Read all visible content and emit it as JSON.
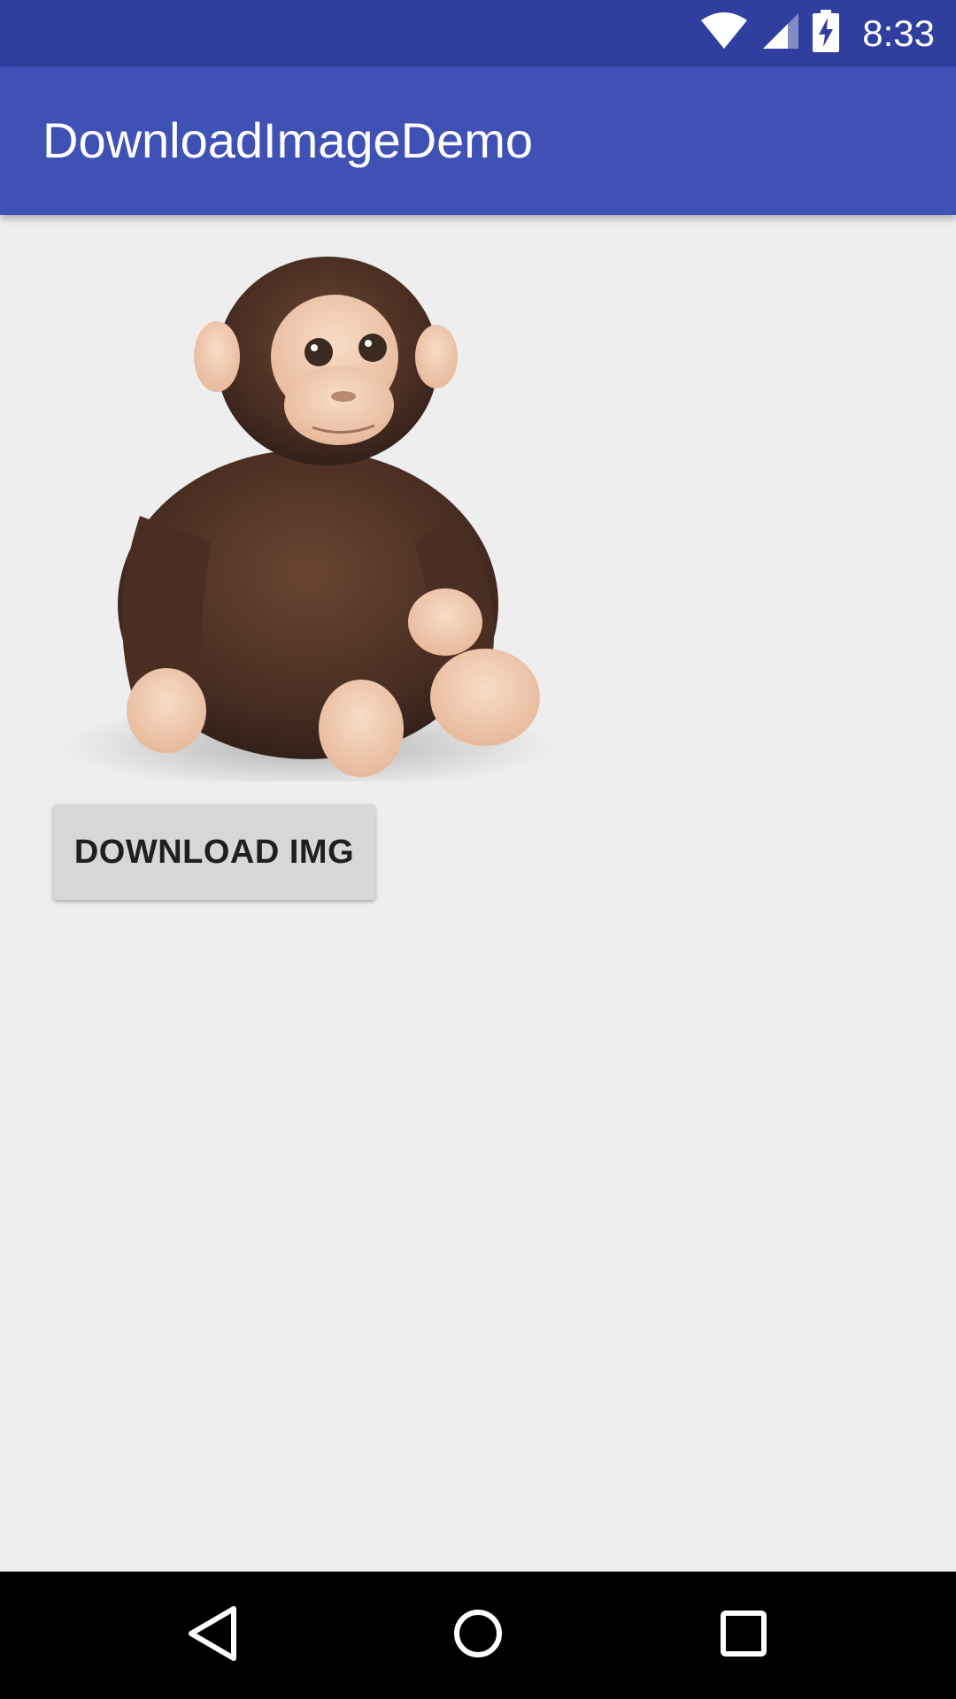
{
  "status_bar": {
    "time": "8:33",
    "background_color": "#303f9f",
    "icons": [
      "wifi-icon",
      "cellular-signal-icon",
      "battery-charging-icon"
    ]
  },
  "app_bar": {
    "title": "DownloadImageDemo",
    "background_color": "#3f51b5"
  },
  "main": {
    "image": {
      "subject": "plush-monkey-toy"
    },
    "download_button": {
      "label": "DOWNLOAD IMG"
    }
  },
  "nav_bar": {
    "buttons": [
      "back-icon",
      "home-icon",
      "recents-icon"
    ]
  }
}
